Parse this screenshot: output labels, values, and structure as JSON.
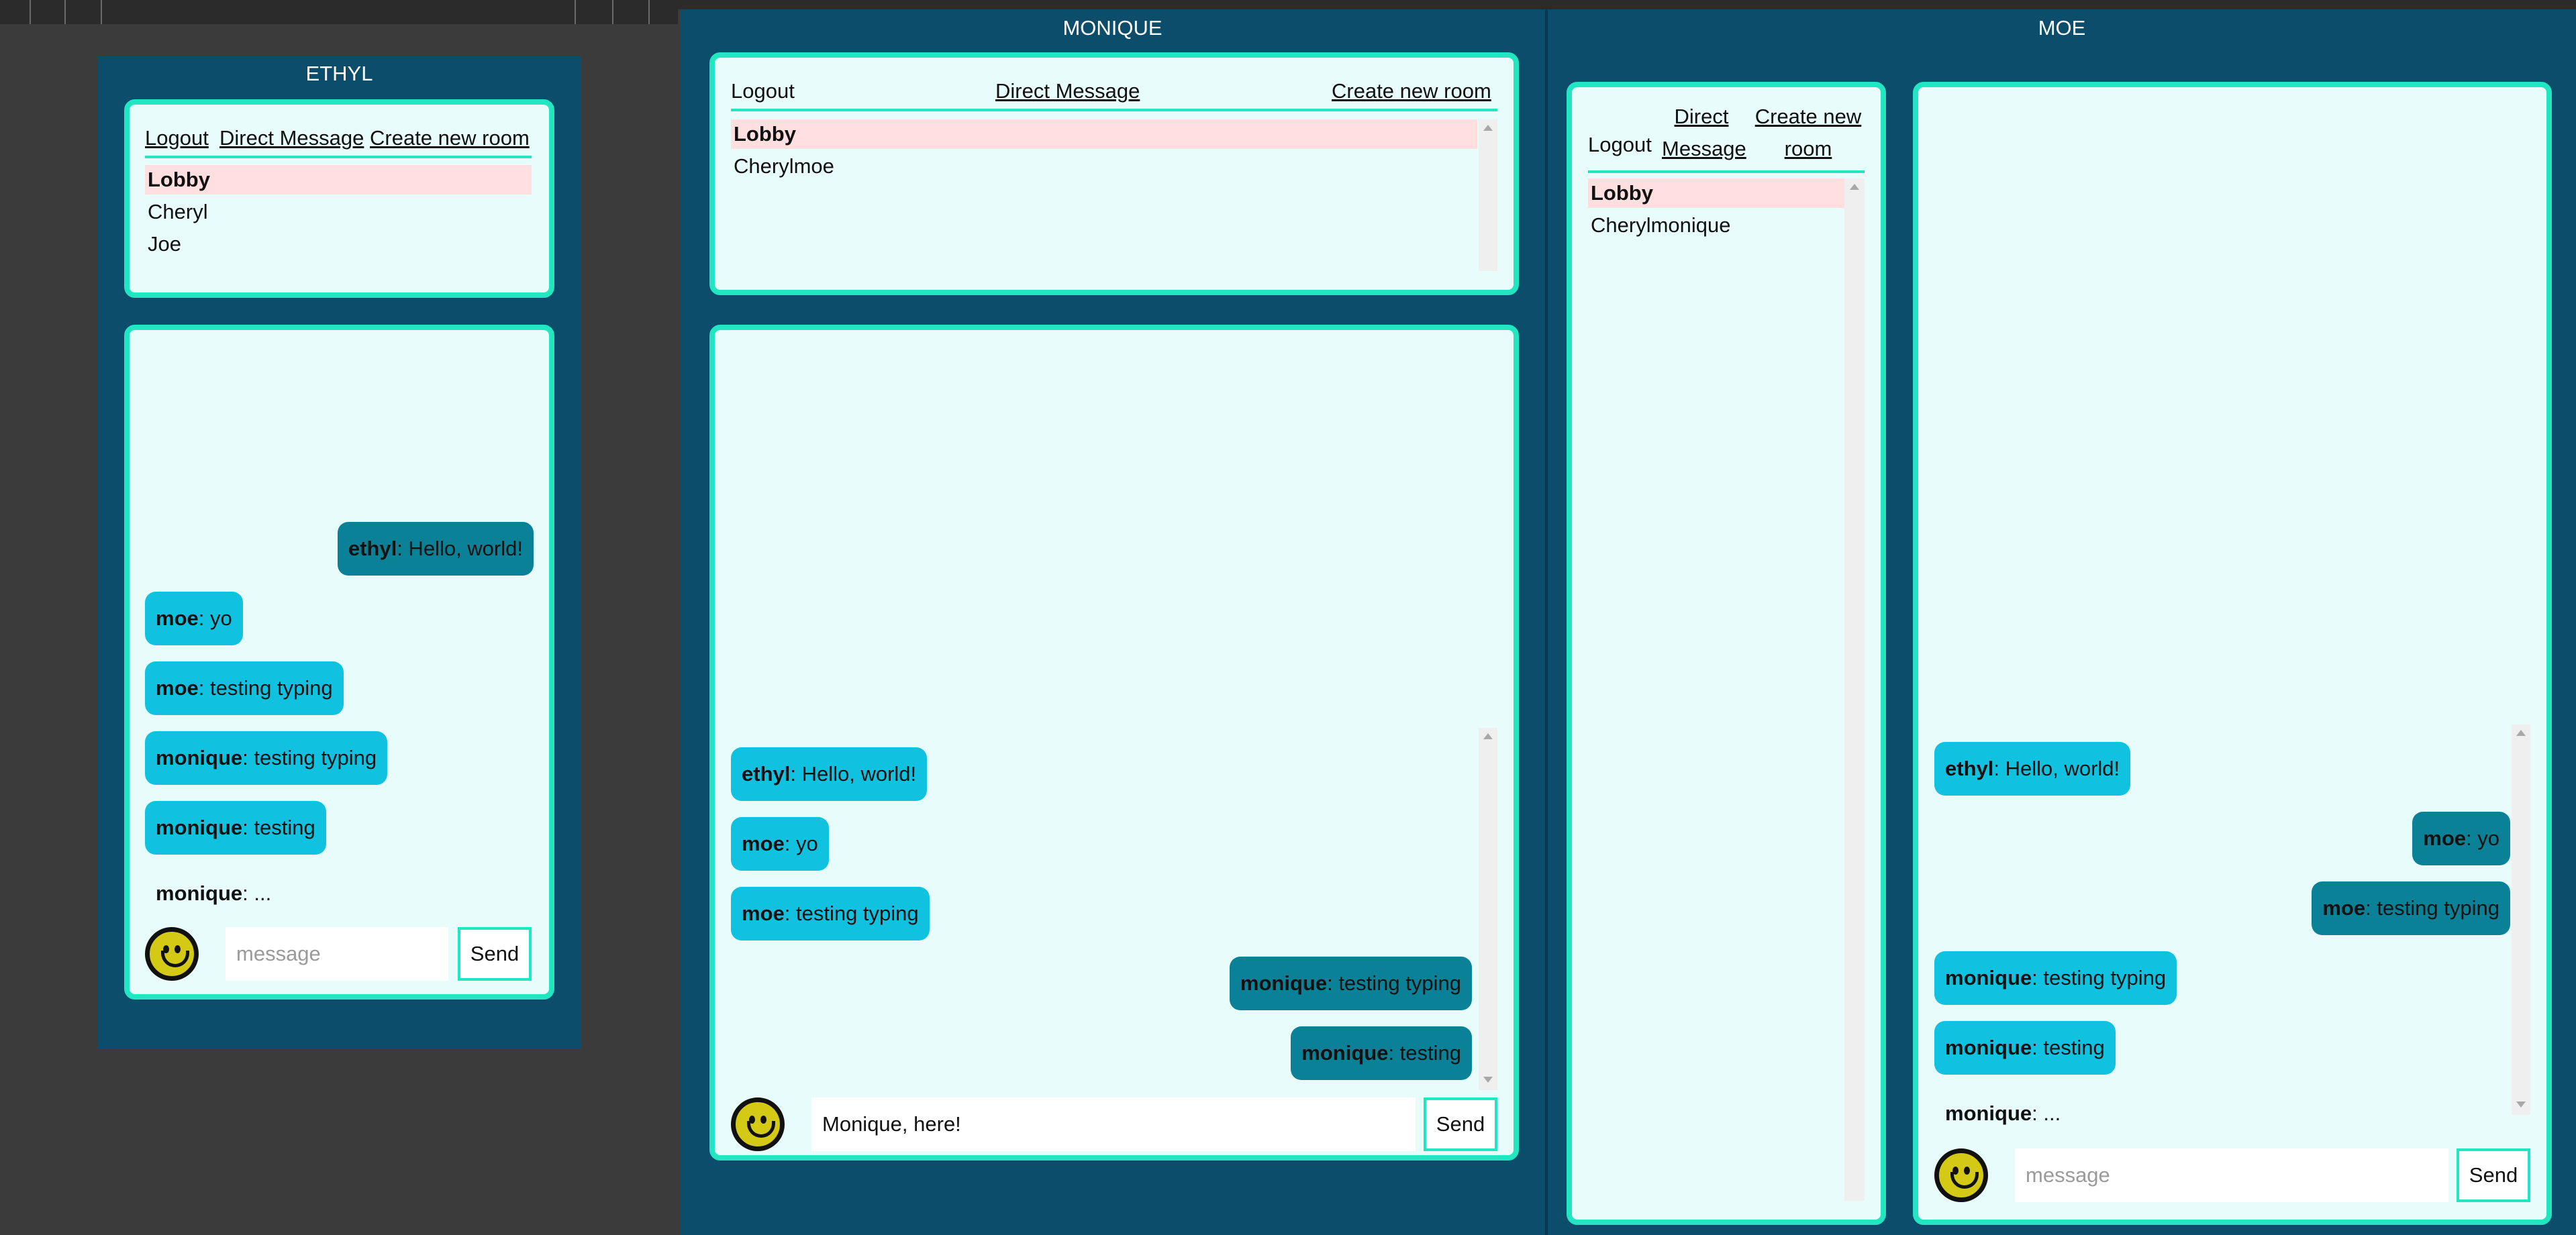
{
  "windows": {
    "ethyl": {
      "title": "ETHYL",
      "nav": {
        "logout": "Logout",
        "direct_message": "Direct Message",
        "create_room": "Create new room"
      },
      "rooms": [
        "Lobby",
        "Cheryl",
        "Joe"
      ],
      "messages": [
        {
          "user": "ethyl",
          "text": ": Hello, world!"
        },
        {
          "user": "moe",
          "text": ": yo"
        },
        {
          "user": "moe",
          "text": ": testing typing"
        },
        {
          "user": "monique",
          "text": ": testing typing"
        },
        {
          "user": "monique",
          "text": ": testing"
        }
      ],
      "typing": {
        "user": "monique",
        "text": ": ..."
      },
      "input": {
        "placeholder": "message",
        "value": ""
      },
      "send_label": "Send"
    },
    "monique": {
      "title": "MONIQUE",
      "nav": {
        "logout": "Logout",
        "direct_message": "Direct Message",
        "create_room": "Create new room"
      },
      "rooms": [
        "Lobby",
        "Cherylmoe"
      ],
      "messages": [
        {
          "user": "ethyl",
          "text": ": Hello, world!"
        },
        {
          "user": "moe",
          "text": ": yo"
        },
        {
          "user": "moe",
          "text": ": testing typing"
        },
        {
          "user": "monique",
          "text": ": testing typing"
        },
        {
          "user": "monique",
          "text": ": testing"
        }
      ],
      "input": {
        "placeholder": "message",
        "value": "Monique, here!"
      },
      "send_label": "Send"
    },
    "moe": {
      "title": "MOE",
      "nav": {
        "logout": "Logout",
        "direct_message_1": "Direct",
        "direct_message_2": "Message",
        "create_room_1": "Create new",
        "create_room_2": "room"
      },
      "rooms": [
        "Lobby",
        "Cherylmonique"
      ],
      "messages": [
        {
          "user": "ethyl",
          "text": ": Hello, world!"
        },
        {
          "user": "moe",
          "text": ": yo"
        },
        {
          "user": "moe",
          "text": ": testing typing"
        },
        {
          "user": "monique",
          "text": ": testing typing"
        },
        {
          "user": "monique",
          "text": ": testing"
        }
      ],
      "typing": {
        "user": "monique",
        "text": ": ..."
      },
      "input": {
        "placeholder": "message",
        "value": ""
      },
      "send_label": "Send"
    }
  },
  "colors": {
    "background": "#3b3b3b",
    "window": "#0b4d6a",
    "panel": "#e8fcfb",
    "accent_border": "#22e6c2",
    "selected_room": "#ffdfe0",
    "bubble_incoming": "#10c2e0",
    "bubble_outgoing": "#0a8196",
    "emoji": "#d4c914"
  },
  "icons": [
    "smiley-emoji-icon",
    "scroll-up-arrow-icon",
    "scroll-down-arrow-icon"
  ]
}
